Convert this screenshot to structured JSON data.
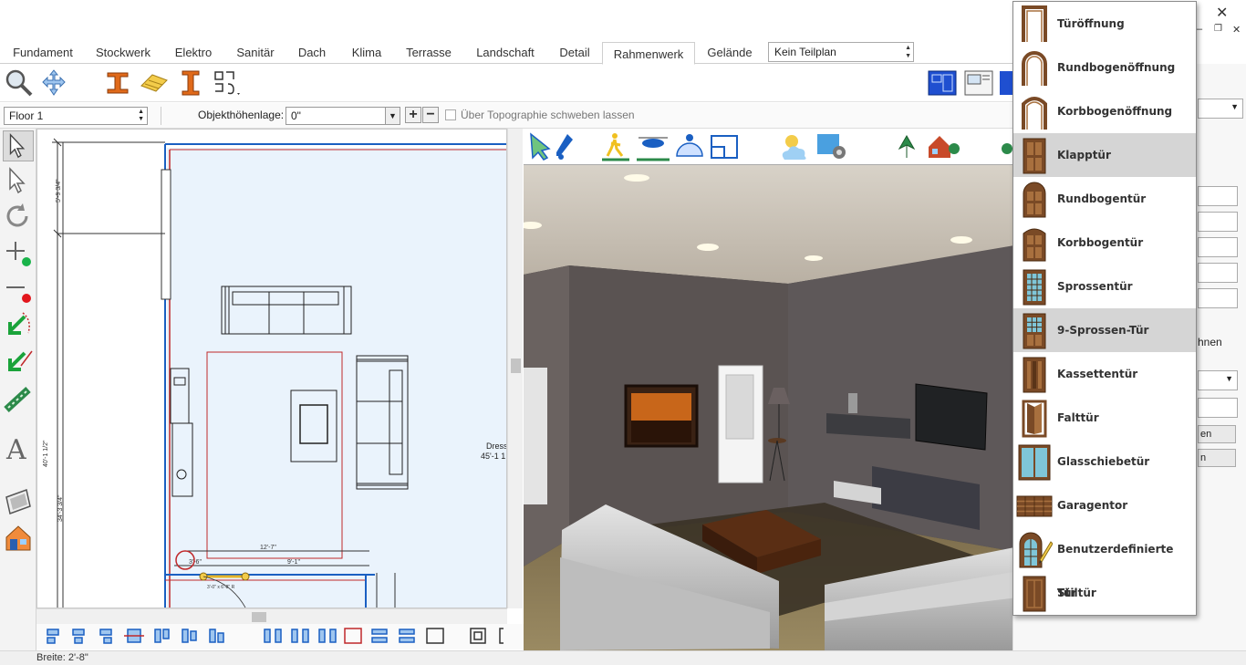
{
  "window": {
    "close_glyph": "✕",
    "minimize_glyph": "–",
    "restore_glyph": "❐",
    "close2_glyph": "✕"
  },
  "tabs": [
    {
      "label": "Fundament"
    },
    {
      "label": "Stockwerk"
    },
    {
      "label": "Elektro"
    },
    {
      "label": "Sanitär"
    },
    {
      "label": "Dach"
    },
    {
      "label": "Klima"
    },
    {
      "label": "Terrasse"
    },
    {
      "label": "Landschaft"
    },
    {
      "label": "Detail"
    },
    {
      "label": "Rahmenwerk",
      "active": true
    },
    {
      "label": "Gelände"
    }
  ],
  "teilplan": {
    "value": "Kein Teilplan"
  },
  "toolbar2": {
    "floor_value": "Floor 1",
    "height_label": "Objekthöhenlage:",
    "height_value": "0\"",
    "float_label": "Über Topographie schweben lassen",
    "float_checked": false
  },
  "plan": {
    "dim_top_left": "5'-9 3/4\"",
    "dim_left_1": "40'-1 1/2\"",
    "dim_left_2": "34'-3 3/4\"",
    "dim_width_rug": "12'-7\"",
    "dim_small_1": "3'-6\"",
    "dim_small_2": "9'-1\"",
    "door_label": "3'-0\" x 6'-8\" R",
    "room_label": "Dress",
    "room_dim": "45'-1 1"
  },
  "right_panel": {
    "partial_text": "hnen",
    "btn1": "en",
    "btn2": "n"
  },
  "door_menu": {
    "items": [
      {
        "label": "Türöffnung",
        "icon": "opening-rect-icon",
        "highlighted": false
      },
      {
        "label": "Rundbogenöffnung",
        "icon": "opening-round-arch-icon",
        "highlighted": false
      },
      {
        "label": "Korbbogenöffnung",
        "icon": "opening-basket-arch-icon",
        "highlighted": false
      },
      {
        "label": "Klapptür",
        "icon": "hinged-door-icon",
        "highlighted": true
      },
      {
        "label": "Rundbogentür",
        "icon": "round-arch-door-icon",
        "highlighted": false
      },
      {
        "label": "Korbbogentür",
        "icon": "basket-arch-door-icon",
        "highlighted": false
      },
      {
        "label": "Sprossentür",
        "icon": "mullion-door-icon",
        "highlighted": false
      },
      {
        "label": "9-Sprossen-Tür",
        "icon": "nine-lite-door-icon",
        "highlighted": true
      },
      {
        "label": "Kassettentür",
        "icon": "panel-door-icon",
        "highlighted": false
      },
      {
        "label": "Falttür",
        "icon": "folding-door-icon",
        "highlighted": false
      },
      {
        "label": "Glasschiebetür",
        "icon": "sliding-glass-door-icon",
        "highlighted": false
      },
      {
        "label": "Garagentor",
        "icon": "garage-door-icon",
        "highlighted": false
      },
      {
        "label": "Benutzerdefinierte Tür",
        "icon": "custom-door-icon",
        "highlighted": false
      },
      {
        "label": "Stiltür",
        "icon": "style-door-icon",
        "highlighted": false
      }
    ]
  },
  "status": {
    "text": "Breite: 2'-8\""
  },
  "colors": {
    "wall_red": "#c0282a",
    "door_brown": "#7a4a26",
    "glass_blue": "#7fc6d8",
    "plan_bg": "#eaf3fc",
    "accent_blue": "#1a5fc2",
    "menu_highlight": "#d5d5d5"
  }
}
